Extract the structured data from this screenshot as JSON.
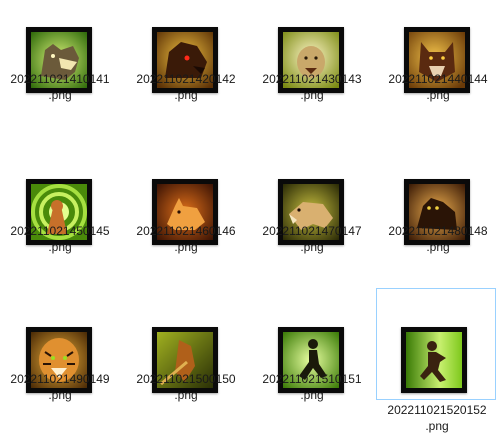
{
  "files": [
    {
      "line1": "202211021410141",
      "line2": ".png",
      "icon": "wolf-head-icon",
      "bg": "#6aa81a",
      "accent": "#f2e6b0"
    },
    {
      "line1": "202211021420142",
      "line2": ".png",
      "icon": "red-eyed-wolf-icon",
      "bg": "#b5750d",
      "accent": "#3a1a08"
    },
    {
      "line1": "202211021430143",
      "line2": ".png",
      "icon": "hyena-pounce-icon",
      "bg": "#c9b23a",
      "accent": "#f5f0d0"
    },
    {
      "line1": "202211021440144",
      "line2": ".png",
      "icon": "werewolf-snarl-icon",
      "bg": "#b0761a",
      "accent": "#5a2a10"
    },
    {
      "line1": "202211021450145",
      "line2": ".png",
      "icon": "shout-vortex-icon",
      "bg": "#6fb81c",
      "accent": "#c7702a"
    },
    {
      "line1": "202211021460146",
      "line2": ".png",
      "icon": "lynx-crouch-icon",
      "bg": "#8a3a08",
      "accent": "#f0a040"
    },
    {
      "line1": "202211021470147",
      "line2": ".png",
      "icon": "hyena-stalk-icon",
      "bg": "#6a6a18",
      "accent": "#d9b070"
    },
    {
      "line1": "202211021480148",
      "line2": ".png",
      "icon": "cougar-stance-icon",
      "bg": "#a35a10",
      "accent": "#2a1406"
    },
    {
      "line1": "202211021490149",
      "line2": ".png",
      "icon": "tiger-roar-icon",
      "bg": "#a06a10",
      "accent": "#f3b23a"
    },
    {
      "line1": "202211021500150",
      "line2": ".png",
      "icon": "spear-thrust-icon",
      "bg": "#6a7a10",
      "accent": "#e0b050"
    },
    {
      "line1": "202211021510151",
      "line2": ".png",
      "icon": "runner-sprint-icon",
      "bg": "#8ac93a",
      "accent": "#1a1a0a"
    },
    {
      "line1": "202211021520152",
      "line2": ".png",
      "icon": "dash-silhouette-icon",
      "bg": "#7ec81c",
      "accent": "#3a2210"
    }
  ]
}
